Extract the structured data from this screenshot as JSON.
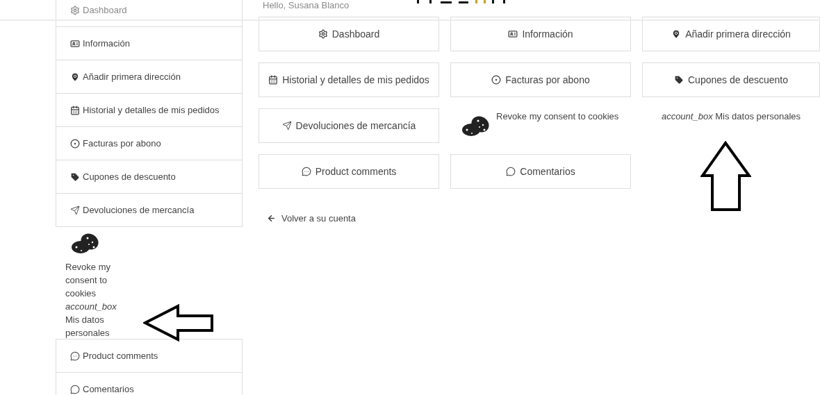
{
  "greeting": {
    "text": "Hello, Susana Blanco",
    "dimmed": true
  },
  "sidebar": {
    "items": [
      {
        "kind": "link",
        "label": "Dashboard",
        "dimmed": true
      },
      {
        "kind": "link",
        "label": "Información",
        "dimmed": false
      },
      {
        "kind": "link",
        "label": "Añadir primera dirección",
        "dimmed": false
      },
      {
        "kind": "link",
        "label": "Historial y detalles de mis pedidos",
        "dimmed": false
      },
      {
        "kind": "link",
        "label": "Facturas por abono",
        "dimmed": false
      },
      {
        "kind": "link",
        "label": "Cupones de descuento",
        "dimmed": false
      },
      {
        "kind": "link",
        "label": "Devoluciones de mercancía",
        "dimmed": false
      },
      {
        "kind": "cookie",
        "label": "Revoke my consent to cookies"
      },
      {
        "kind": "plain",
        "label": "*account_box* Mis datos personales"
      },
      {
        "kind": "link",
        "label": "Product comments",
        "dimmed": false
      },
      {
        "kind": "link",
        "label": "Comentarios",
        "dimmed": false
      }
    ]
  },
  "cards": [
    {
      "kind": "link",
      "label": "Dashboard"
    },
    {
      "kind": "link",
      "label": "Información"
    },
    {
      "kind": "link",
      "label": "Añadir primera dirección"
    },
    {
      "kind": "link",
      "label": "Historial y detalles de mis pedidos"
    },
    {
      "kind": "link",
      "label": "Facturas por abono"
    },
    {
      "kind": "link",
      "label": "Cupones de descuento"
    },
    {
      "kind": "link",
      "label": "Devoluciones de mercancía"
    },
    {
      "kind": "cookie",
      "label": "Revoke my consent to cookies"
    },
    {
      "kind": "plain",
      "label": "*account_box* Mis datos personales"
    },
    {
      "kind": "link",
      "label": "Product comments"
    },
    {
      "kind": "link",
      "label": "Comentarios"
    }
  ],
  "back_link": "Volver a su cuenta"
}
